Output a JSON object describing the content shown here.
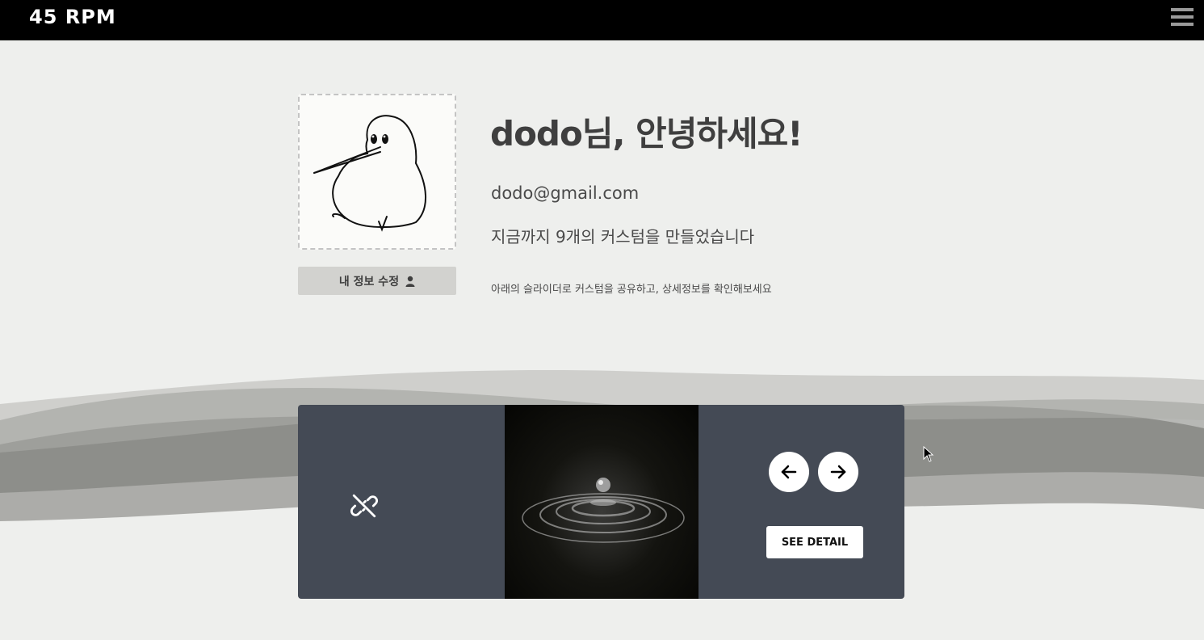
{
  "header": {
    "logo": "45 RPM",
    "menu_icon": "hamburger-menu-icon"
  },
  "profile": {
    "avatar_icon": "kiwi-bird-avatar",
    "edit_button_label": "내 정보 수정",
    "edit_button_icon": "user-icon",
    "greeting": "dodo님, 안녕하세요!",
    "email": "dodo@gmail.com",
    "custom_count_text": "지금까지 9개의 커스텀을 만들었습니다",
    "hint": "아래의 슬라이더로 커스텀을 공유하고, 상세정보를 확인해보세요"
  },
  "slider": {
    "share_icon": "unlink-icon",
    "artwork": "water-drop-ripple-image",
    "prev_icon": "arrow-left-icon",
    "next_icon": "arrow-right-icon",
    "detail_label": "SEE DETAIL",
    "panel_color": "#444a55"
  },
  "colors": {
    "topbar": "#000000",
    "background": "#eeefed",
    "edit_button": "#d2d2cf"
  }
}
